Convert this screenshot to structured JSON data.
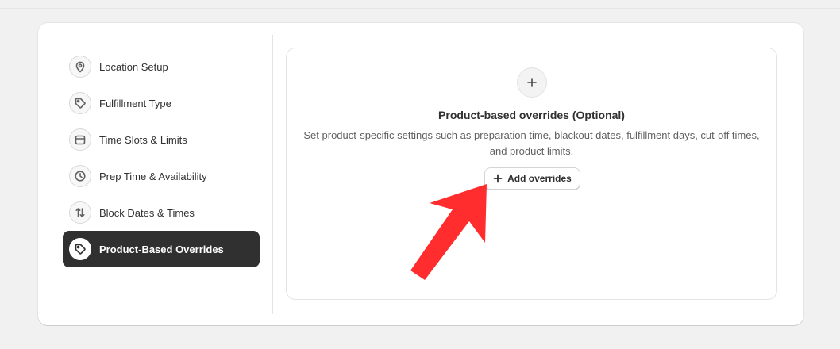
{
  "sidebar": {
    "items": [
      {
        "label": "Location Setup",
        "icon": "location-pin-icon",
        "active": false
      },
      {
        "label": "Fulfillment Type",
        "icon": "tag-icon",
        "active": false
      },
      {
        "label": "Time Slots & Limits",
        "icon": "calendar-icon",
        "active": false
      },
      {
        "label": "Prep Time & Availability",
        "icon": "clock-icon",
        "active": false
      },
      {
        "label": "Block Dates & Times",
        "icon": "arrows-up-down-icon",
        "active": false
      },
      {
        "label": "Product-Based Overrides",
        "icon": "tag-icon",
        "active": true
      }
    ]
  },
  "panel": {
    "icon": "plus-icon",
    "title": "Product-based overrides (Optional)",
    "description": "Set product-specific settings such as preparation time, blackout dates, fulfillment days, cut-off times, and product limits.",
    "add_button_label": "Add overrides"
  },
  "annotation": {
    "type": "arrow",
    "color": "#ff2d2d",
    "points_to": "Add overrides"
  },
  "colors": {
    "active_nav_bg": "#303030",
    "page_bg": "#f1f1f1"
  }
}
